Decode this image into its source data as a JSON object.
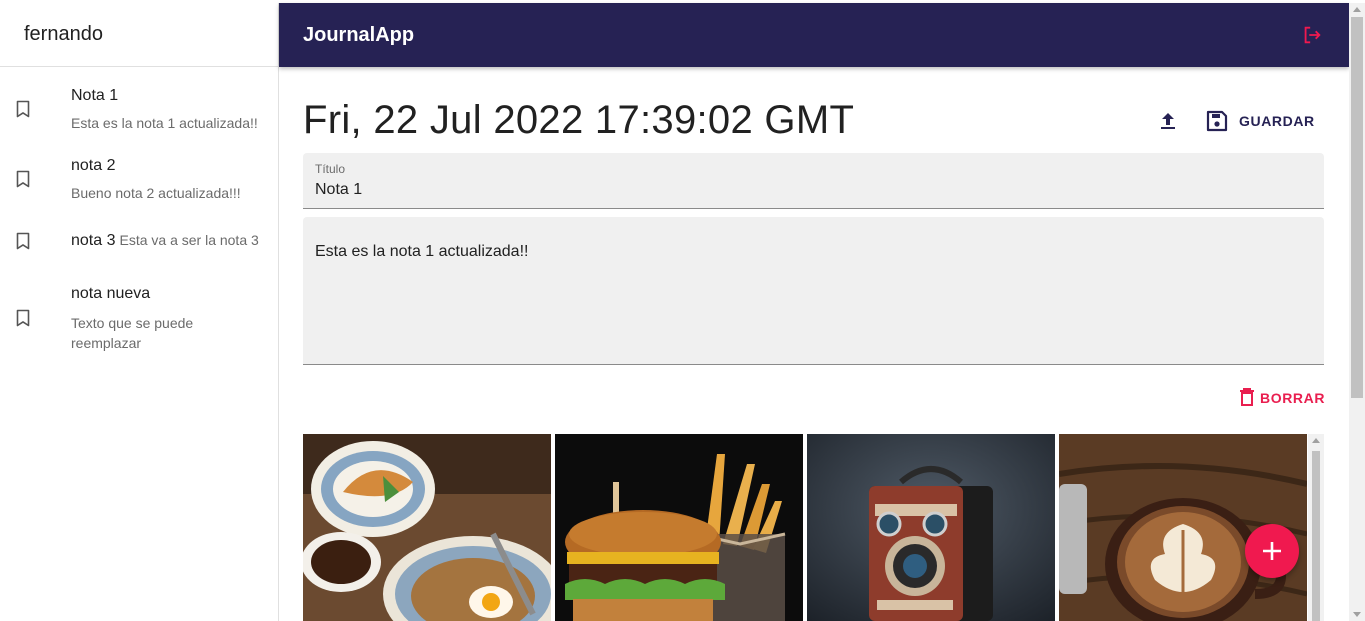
{
  "sidebar": {
    "user_name": "fernando",
    "notes": [
      {
        "title": "Nota 1",
        "body": "Esta es la nota 1 actualizada!!"
      },
      {
        "title": "nota 2",
        "body": "Bueno nota 2 actualizada!!!"
      },
      {
        "title": "nota 3",
        "body": "Esta va a ser la nota 3"
      },
      {
        "title": "nota nueva",
        "body": "Texto que se puede reemplazar"
      }
    ]
  },
  "appbar": {
    "title": "JournalApp",
    "logout_icon": "logout-icon"
  },
  "editor": {
    "date": "Fri, 22 Jul 2022 17:39:02 GMT",
    "upload_icon": "upload-icon",
    "save_label": "GUARDAR",
    "title_label": "Título",
    "title_value": "Nota 1",
    "body_value": "Esta es la nota 1 actualizada!!",
    "delete_label": "BORRAR"
  },
  "gallery": {
    "images": [
      "croissant-breakfast-photo",
      "burger-fries-photo",
      "vintage-camera-photo",
      "latte-art-photo"
    ]
  },
  "colors": {
    "appbar": "#262254",
    "accent": "#f0194f",
    "field_bg": "#f0f0f0"
  }
}
